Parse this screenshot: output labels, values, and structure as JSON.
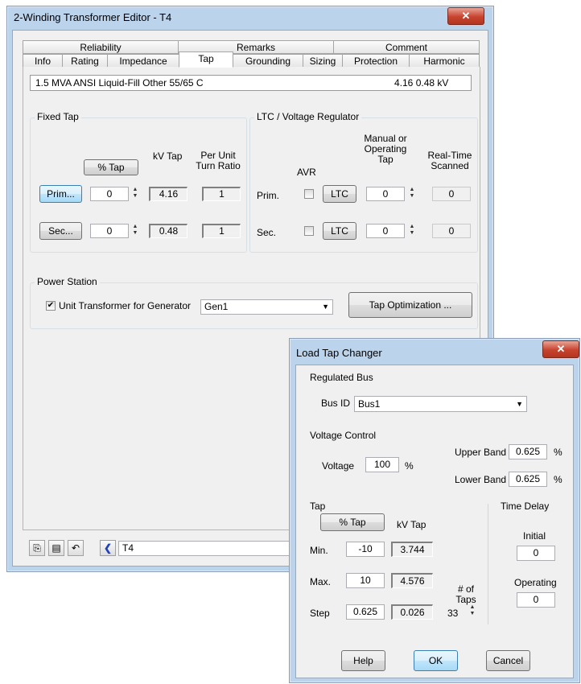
{
  "main_window": {
    "title": "2-Winding Transformer Editor - T4",
    "close_glyph": "✕",
    "tabs_row1": [
      "Reliability",
      "Remarks",
      "Comment"
    ],
    "tabs_row2": [
      "Info",
      "Rating",
      "Impedance",
      "Tap",
      "Grounding",
      "Sizing",
      "Protection",
      "Harmonic"
    ],
    "active_tab": "Tap",
    "info_bar": {
      "summary": "1.5 MVA  ANSI  Liquid-Fill  Other  55/65 C",
      "kv": "4.16   0.48 kV"
    },
    "fixed_tap": {
      "label": "Fixed Tap",
      "pct_tap_button": "% Tap",
      "kv_tap_header": "kV Tap",
      "pu_header": "Per Unit Turn Ratio",
      "prim_button": "Prim...",
      "sec_button": "Sec...",
      "prim_tap": "0",
      "sec_tap": "0",
      "prim_kv": "4.16",
      "sec_kv": "0.48",
      "prim_pu": "1",
      "sec_pu": "1"
    },
    "ltc": {
      "label": "LTC / Voltage Regulator",
      "avr_header": "AVR",
      "manual_header": "Manual or Operating Tap",
      "realtime_header": "Real-Time Scanned",
      "prim_label": "Prim.",
      "sec_label": "Sec.",
      "ltc_button": "LTC",
      "prim_tap": "0",
      "sec_tap": "0",
      "prim_scanned": "0",
      "sec_scanned": "0"
    },
    "power_station": {
      "label": "Power Station",
      "unit_transformer_label": "Unit Transformer for Generator",
      "unit_transformer_checked": true,
      "generator": "Gen1",
      "tap_optimization_button": "Tap Optimization ..."
    },
    "footer": {
      "id_value": "T4"
    }
  },
  "ltc_dialog": {
    "title": "Load Tap Changer",
    "close_glyph": "✕",
    "regulated_bus_label": "Regulated Bus",
    "bus_id_label": "Bus ID",
    "bus_id_value": "Bus1",
    "voltage_control_label": "Voltage Control",
    "voltage_label": "Voltage",
    "voltage_value": "100",
    "voltage_unit": "%",
    "upper_band_label": "Upper Band",
    "upper_band_value": "0.625",
    "lower_band_label": "Lower Band",
    "lower_band_value": "0.625",
    "band_unit": "%",
    "tap_label": "Tap",
    "pct_tap_button": "% Tap",
    "kv_tap_header": "kV Tap",
    "min_label": "Min.",
    "min_tap": "-10",
    "min_kv": "3.744",
    "max_label": "Max.",
    "max_tap": "10",
    "max_kv": "4.576",
    "step_label": "Step",
    "step_tap": "0.625",
    "step_kv": "0.026",
    "num_taps_label": "# of Taps",
    "num_taps_value": "33",
    "time_delay_label": "Time Delay",
    "initial_label": "Initial",
    "initial_value": "0",
    "operating_label": "Operating",
    "operating_value": "0",
    "help_button": "Help",
    "ok_button": "OK",
    "cancel_button": "Cancel"
  }
}
